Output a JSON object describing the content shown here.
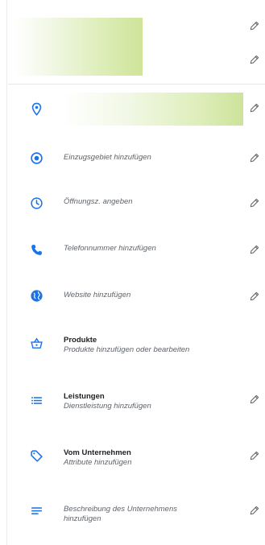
{
  "colors": {
    "accent_blue": "#1a73e8",
    "edit_gray": "#5f6368",
    "redaction_green": "#cfe49a"
  },
  "header": {
    "business_name": "",
    "edit_icon": "pencil-icon"
  },
  "address": {
    "icon": "location-pin-icon",
    "value": ""
  },
  "rows": [
    {
      "icon": "target-circle-icon",
      "label": "Einzugsgebiet hinzufügen"
    },
    {
      "icon": "clock-icon",
      "label": "Öffnungsz. angeben"
    },
    {
      "icon": "phone-icon",
      "label": "Telefonnummer hinzufügen"
    },
    {
      "icon": "globe-icon",
      "label": "Website hinzufügen"
    }
  ],
  "products": {
    "icon": "basket-icon",
    "title": "Produkte",
    "subtitle": "Produkte hinzufügen oder bearbeiten"
  },
  "services": {
    "icon": "list-icon",
    "title": "Leistungen",
    "subtitle": "Dienstleistung hinzufügen"
  },
  "attributes": {
    "icon": "tag-icon",
    "title": "Vom Unternehmen",
    "subtitle": "Attribute hinzufügen"
  },
  "description": {
    "icon": "text-lines-icon",
    "label_line1": "Beschreibung des Unternehmens",
    "label_line2": "hinzufügen"
  }
}
